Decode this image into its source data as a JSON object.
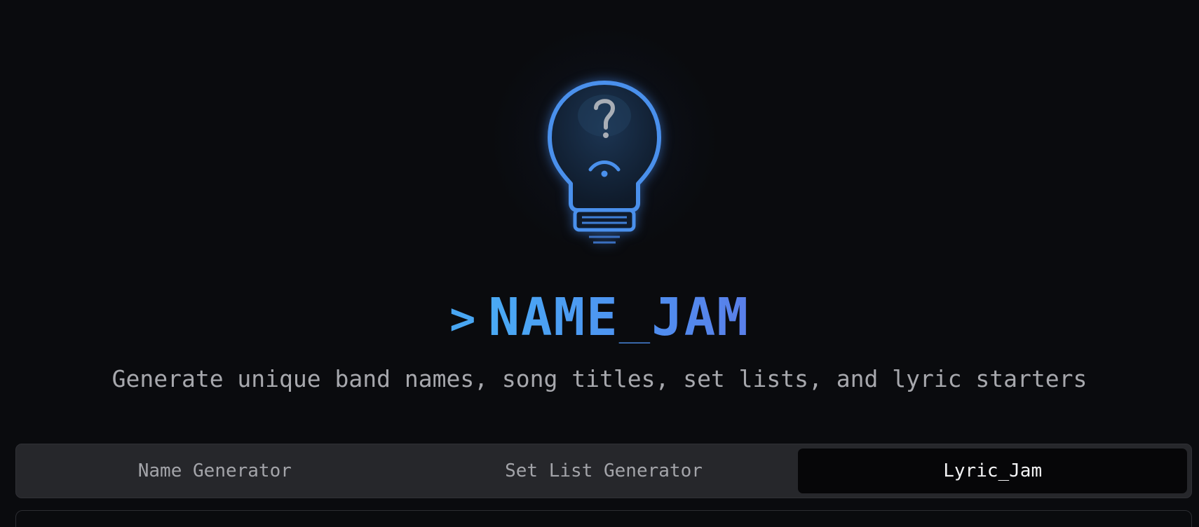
{
  "header": {
    "prompt_symbol": ">",
    "title": "NAME_JAM",
    "subtitle": "Generate unique band names, song titles, set lists, and lyric starters",
    "logo_icon": "lightbulb-question-icon"
  },
  "tabs": [
    {
      "label": "Name Generator",
      "active": false
    },
    {
      "label": "Set List Generator",
      "active": false
    },
    {
      "label": "Lyric_Jam",
      "active": true
    }
  ],
  "colors": {
    "background": "#0a0b0e",
    "accent": "#4a9ef2",
    "tab_bar": "#26272b",
    "tab_active": "#060608"
  }
}
